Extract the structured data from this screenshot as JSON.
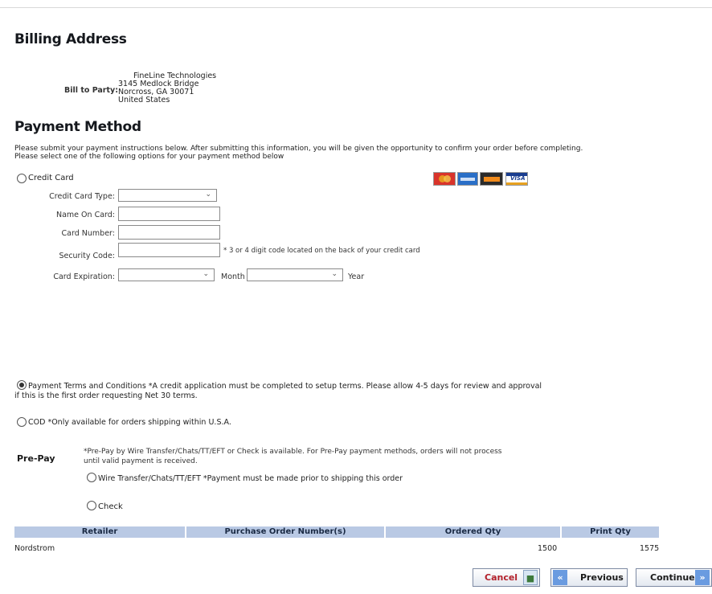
{
  "billing": {
    "heading": "Billing Address",
    "bill_to_label": "Bill to Party:",
    "address_lines": [
      "FineLine Technologies",
      "3145 Medlock Bridge",
      "Norcross, GA 30071",
      "United States"
    ]
  },
  "payment": {
    "heading": "Payment Method",
    "instructions_line1": "Please submit your payment instructions below. After submitting this information, you will be given the opportunity to confirm your order before completing.",
    "instructions_line2": "Please select one of the following options for your payment method below",
    "credit_card": {
      "option_label": "Credit Card",
      "card_type_label": "Credit Card Type:",
      "card_type_value": "",
      "name_label": "Name On Card:",
      "name_value": "",
      "number_label": "Card Number:",
      "number_value": "",
      "security_label": "Security Code:",
      "security_value": "",
      "security_note": "* 3 or 4 digit code located on the back of your credit card",
      "expiration_label": "Card Expiration:",
      "month_label": "Month",
      "year_label": "Year",
      "card_logos": [
        {
          "name": "MasterCard",
          "color": "#d9342b"
        },
        {
          "name": "American Express",
          "color": "#2a6fc7"
        },
        {
          "name": "Discover",
          "color": "#f08a1c"
        },
        {
          "name": "VISA",
          "color": "#1a3d8f"
        }
      ]
    },
    "terms": {
      "label_line1": "Payment Terms and Conditions *A credit application must be completed to setup terms. Please allow 4-5 days for review and approval",
      "label_line2": "if this is the first order requesting Net 30 terms.",
      "selected": true
    },
    "cod": {
      "label": "COD *Only available for orders shipping within U.S.A."
    },
    "prepay": {
      "heading": "Pre-Pay",
      "note_line1": "*Pre-Pay by Wire Transfer/Chats/TT/EFT or Check is available. For Pre-Pay payment methods, orders will not process",
      "note_line2": "until valid payment is received.",
      "wire_label": "Wire Transfer/Chats/TT/EFT *Payment must be made prior to shipping this order",
      "check_label": "Check"
    }
  },
  "order_table": {
    "headers": [
      "Retailer",
      "Purchase Order Number(s)",
      "Ordered Qty",
      "Print Qty"
    ],
    "rows": [
      {
        "retailer": "Nordstrom",
        "po": "",
        "ordered_qty": "1500",
        "print_qty": "1575"
      }
    ]
  },
  "buttons": {
    "cancel": "Cancel",
    "previous": "Previous",
    "continue": "Continue"
  },
  "colors": {
    "table_header_bg": "#b9c9e4",
    "cancel_text": "#b3202a",
    "nav_icon_bg": "#6a9be0"
  }
}
